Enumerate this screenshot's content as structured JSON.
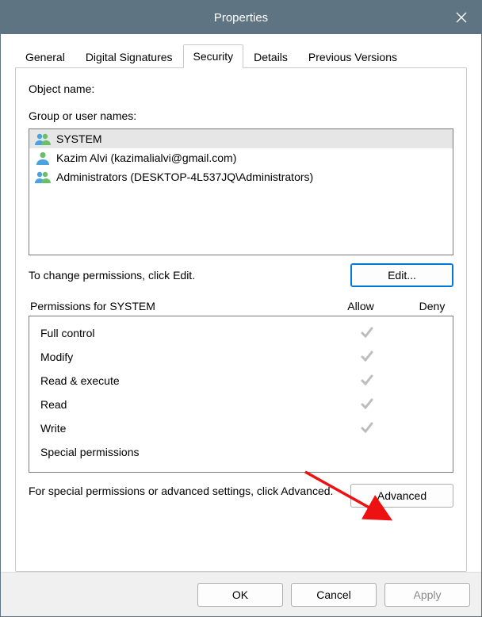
{
  "title": "Properties",
  "tabs": {
    "general": "General",
    "digisig": "Digital Signatures",
    "security": "Security",
    "details": "Details",
    "prev": "Previous Versions"
  },
  "labels": {
    "object_name": "Object name:",
    "group_users": "Group or user names:",
    "change_hint": "To change permissions, click Edit.",
    "perm_for": "Permissions for SYSTEM",
    "allow": "Allow",
    "deny": "Deny",
    "adv_hint": "For special permissions or advanced settings, click Advanced."
  },
  "users": [
    {
      "name": "SYSTEM",
      "icon": "group"
    },
    {
      "name": "Kazim Alvi (kazimalialvi@gmail.com)",
      "icon": "user"
    },
    {
      "name": "Administrators (DESKTOP-4L537JQ\\Administrators)",
      "icon": "group"
    }
  ],
  "perms": [
    {
      "name": "Full control",
      "allow": true,
      "deny": false
    },
    {
      "name": "Modify",
      "allow": true,
      "deny": false
    },
    {
      "name": "Read & execute",
      "allow": true,
      "deny": false
    },
    {
      "name": "Read",
      "allow": true,
      "deny": false
    },
    {
      "name": "Write",
      "allow": true,
      "deny": false
    },
    {
      "name": "Special permissions",
      "allow": false,
      "deny": false
    }
  ],
  "buttons": {
    "edit": "Edit...",
    "advanced": "Advanced",
    "ok": "OK",
    "cancel": "Cancel",
    "apply": "Apply"
  }
}
